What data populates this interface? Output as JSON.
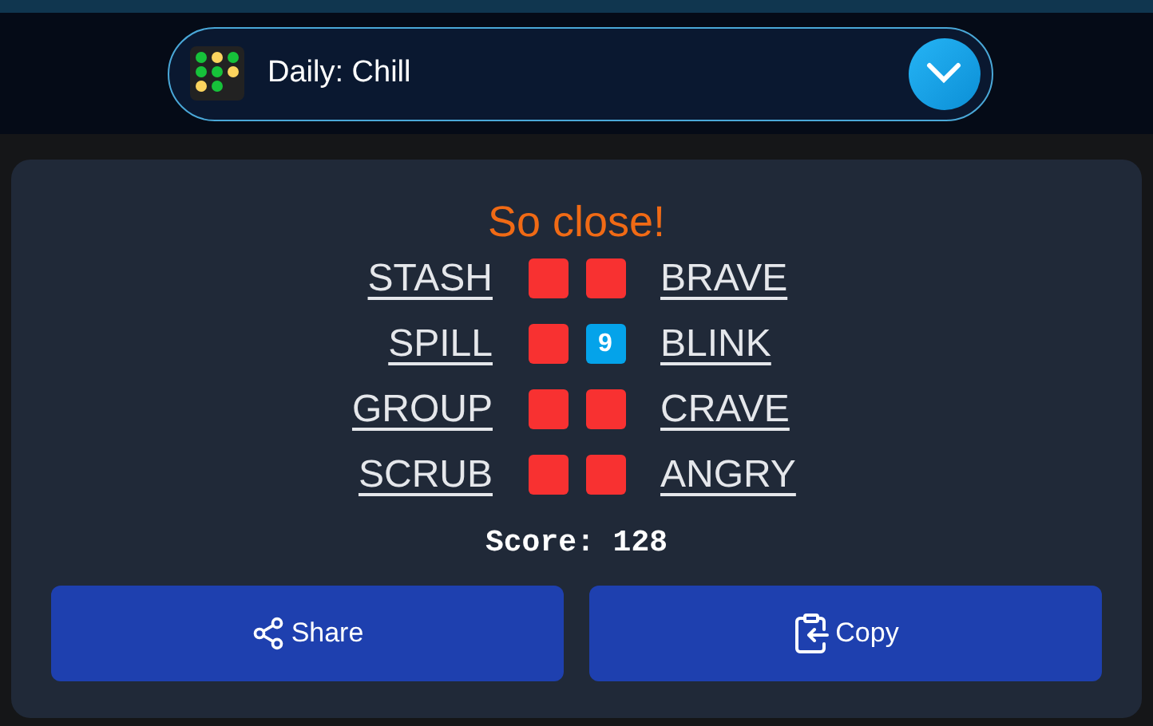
{
  "selector": {
    "label": "Daily: Chill"
  },
  "result": {
    "title": "So close!",
    "rows": [
      {
        "left": "STASH",
        "right": "BRAVE",
        "marks": [
          {
            "kind": "miss"
          },
          {
            "kind": "miss"
          }
        ]
      },
      {
        "left": "SPILL",
        "right": "BLINK",
        "marks": [
          {
            "kind": "miss"
          },
          {
            "kind": "hit",
            "text": "9"
          }
        ]
      },
      {
        "left": "GROUP",
        "right": "CRAVE",
        "marks": [
          {
            "kind": "miss"
          },
          {
            "kind": "miss"
          }
        ]
      },
      {
        "left": "SCRUB",
        "right": "ANGRY",
        "marks": [
          {
            "kind": "miss"
          },
          {
            "kind": "miss"
          }
        ]
      }
    ],
    "score": "Score: 128"
  },
  "buttons": [
    {
      "kind": "share",
      "label": "Share"
    },
    {
      "kind": "copy",
      "label": "Copy"
    }
  ]
}
